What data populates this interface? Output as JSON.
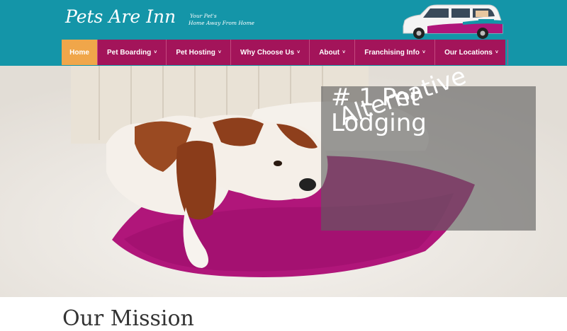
{
  "header": {
    "logo_text": "Pets Are Inn",
    "tagline_line1": "Your Pet's",
    "tagline_line2": "Home Away From Home"
  },
  "nav": {
    "items": [
      {
        "label": "Home",
        "active": true
      },
      {
        "label": "Pet Boarding"
      },
      {
        "label": "Pet Hosting"
      },
      {
        "label": "Why Choose Us"
      },
      {
        "label": "About"
      },
      {
        "label": "Franchising Info"
      },
      {
        "label": "Our Locations"
      }
    ],
    "dropdown_glyph": "˅"
  },
  "hero": {
    "line1": "# 1 Pet",
    "line2": "Lodging",
    "line3": "Alternative"
  },
  "mission": {
    "heading": "Our Mission"
  },
  "colors": {
    "header_bg": "#1495a8",
    "nav_bg": "#a3145a",
    "nav_active": "#f0a64a",
    "pillow": "#b0167a"
  },
  "icons": {
    "van": "pets-are-inn-van-image",
    "hero_image": "dog-on-pillow-photo"
  }
}
